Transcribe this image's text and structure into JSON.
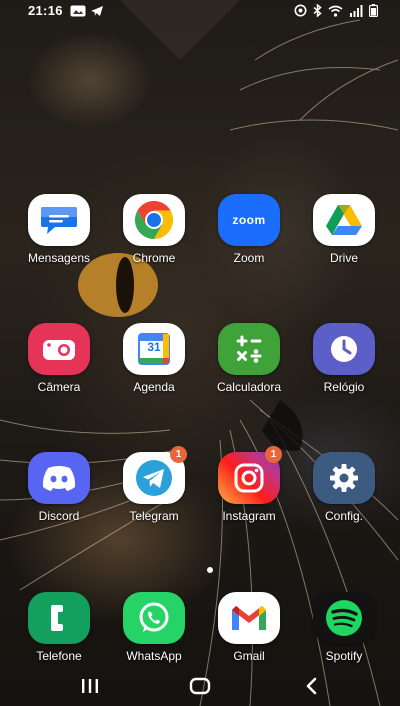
{
  "status_bar": {
    "time": "21:16",
    "icons": [
      "gallery-icon",
      "telegram-icon",
      "location-icon",
      "bluetooth-icon",
      "wifi-icon",
      "signal-icon",
      "battery-icon"
    ]
  },
  "apps": [
    {
      "name": "Mensagens",
      "icon": "messages-icon"
    },
    {
      "name": "Chrome",
      "icon": "chrome-icon"
    },
    {
      "name": "Zoom",
      "icon": "zoom-icon",
      "icon_text": "zoom"
    },
    {
      "name": "Drive",
      "icon": "drive-icon"
    },
    {
      "name": "Câmera",
      "icon": "camera-icon"
    },
    {
      "name": "Agenda",
      "icon": "calendar-icon",
      "icon_text": "31"
    },
    {
      "name": "Calculadora",
      "icon": "calculator-icon"
    },
    {
      "name": "Relógio",
      "icon": "clock-icon"
    },
    {
      "name": "Discord",
      "icon": "discord-icon"
    },
    {
      "name": "Telegram",
      "icon": "telegram-icon",
      "badge": "1"
    },
    {
      "name": "Instagram",
      "icon": "instagram-icon",
      "badge": "1"
    },
    {
      "name": "Config.",
      "icon": "settings-icon"
    }
  ],
  "dock": [
    {
      "name": "Telefone",
      "icon": "phone-icon"
    },
    {
      "name": "WhatsApp",
      "icon": "whatsapp-icon"
    },
    {
      "name": "Gmail",
      "icon": "gmail-icon"
    },
    {
      "name": "Spotify",
      "icon": "spotify-icon"
    }
  ],
  "page_indicator": {
    "pages": 1,
    "current": 1
  },
  "nav": [
    "recents-icon",
    "home-icon",
    "back-icon"
  ],
  "colors": {
    "label": "#ffffff",
    "badge": "#e8663a",
    "camera": "#e63459",
    "zoom": "#1b6dfb",
    "calculator": "#3fa33a",
    "clock": "#5b5fc7",
    "discord": "#5865f2",
    "phone": "#13a05e",
    "whatsapp": "#25d366",
    "spotify": "#1ed760"
  }
}
